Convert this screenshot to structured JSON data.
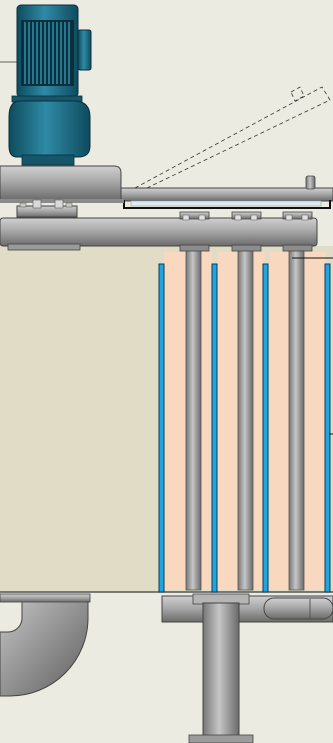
{
  "colors": {
    "background": "#ecebe2",
    "tank_fill": "#e0dcc6",
    "motor_teal": "#1f6f88",
    "motor_dark": "#0e3e4e",
    "steel_light": "#b9b9b9",
    "steel_dark": "#6f6f6f",
    "heating_zone": "#f8d9bf",
    "blue_rod": "#1fa6e0"
  },
  "components": {
    "motor": "motor-icon",
    "gearbox": "gearbox-icon",
    "hinged_lid": "hinged-lid-icon",
    "heater_elements": 3,
    "blue_rods": 4
  }
}
